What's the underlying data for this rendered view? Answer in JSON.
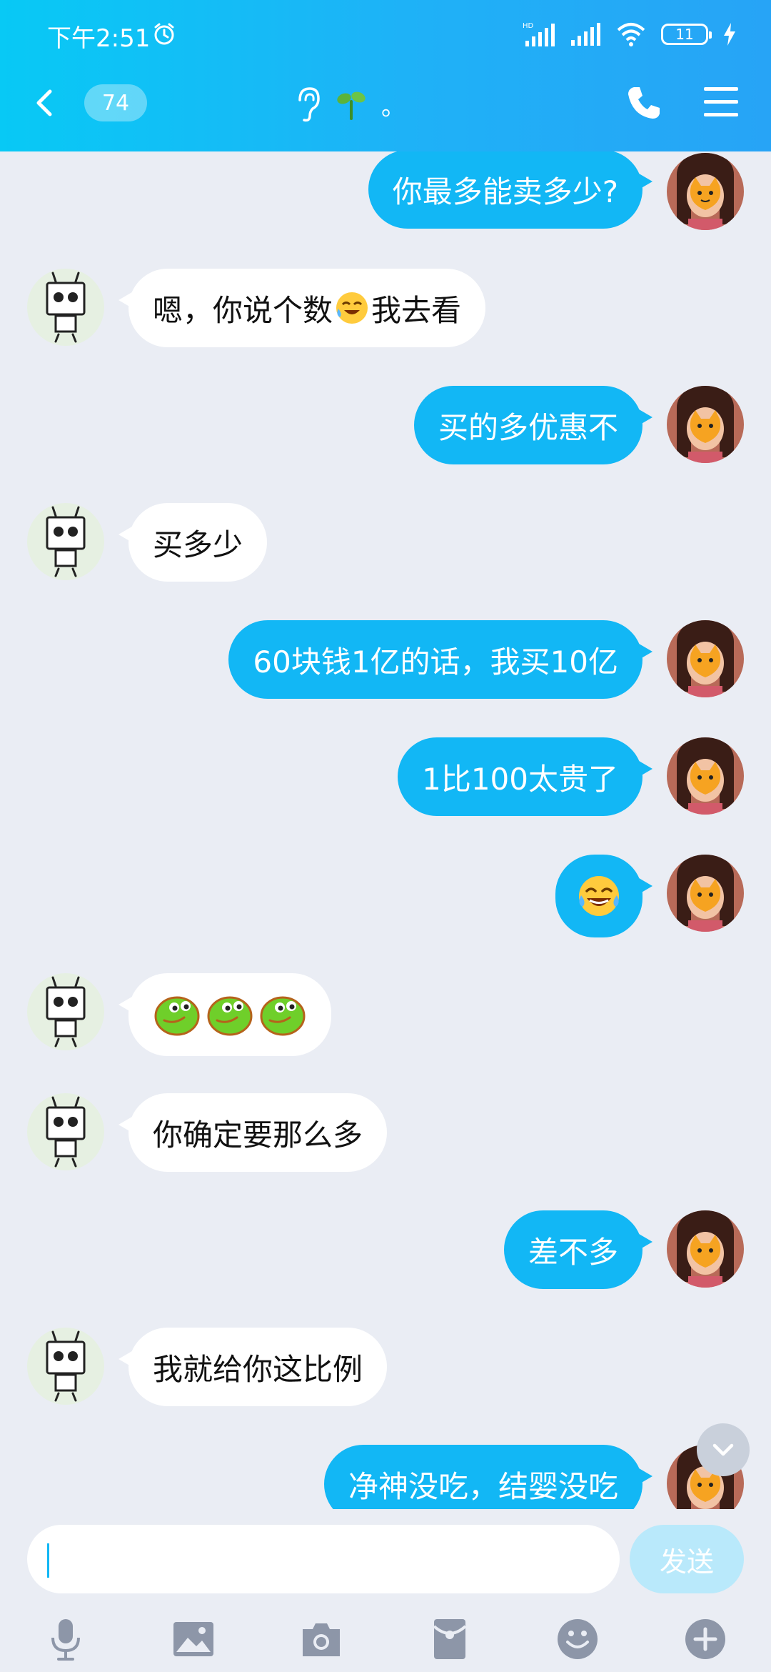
{
  "status_bar": {
    "time": "下午2:51",
    "battery": "11"
  },
  "header": {
    "unread_count": "74",
    "title_suffix": "。"
  },
  "messages": [
    {
      "side": "mine",
      "text": "你最多能卖多少?"
    },
    {
      "side": "theirs",
      "text_before": "嗯，你说个数",
      "text_after": "我去看"
    },
    {
      "side": "mine",
      "text": "买的多优惠不"
    },
    {
      "side": "theirs",
      "text": "买多少"
    },
    {
      "side": "mine",
      "text": "60块钱1亿的话，我买10亿"
    },
    {
      "side": "mine",
      "text": "1比100太贵了"
    },
    {
      "side": "mine",
      "emoji": "laugh-cry"
    },
    {
      "side": "theirs",
      "emoji": "green-bean",
      "count": 3
    },
    {
      "side": "theirs",
      "text": "你确定要那么多"
    },
    {
      "side": "mine",
      "text": "差不多"
    },
    {
      "side": "theirs",
      "text": "我就给你这比例"
    },
    {
      "side": "mine",
      "text": "净神没吃，结婴没吃"
    }
  ],
  "input": {
    "placeholder": "",
    "send_label": "发送"
  },
  "toolbar_icons": [
    "mic-icon",
    "image-icon",
    "camera-icon",
    "red-packet-icon",
    "emoji-icon",
    "plus-icon"
  ],
  "colors": {
    "header_start": "#08c9f5",
    "header_end": "#27a4f6",
    "my_bubble": "#12b7f5",
    "their_bubble": "#ffffff",
    "background": "#eaedf4"
  }
}
